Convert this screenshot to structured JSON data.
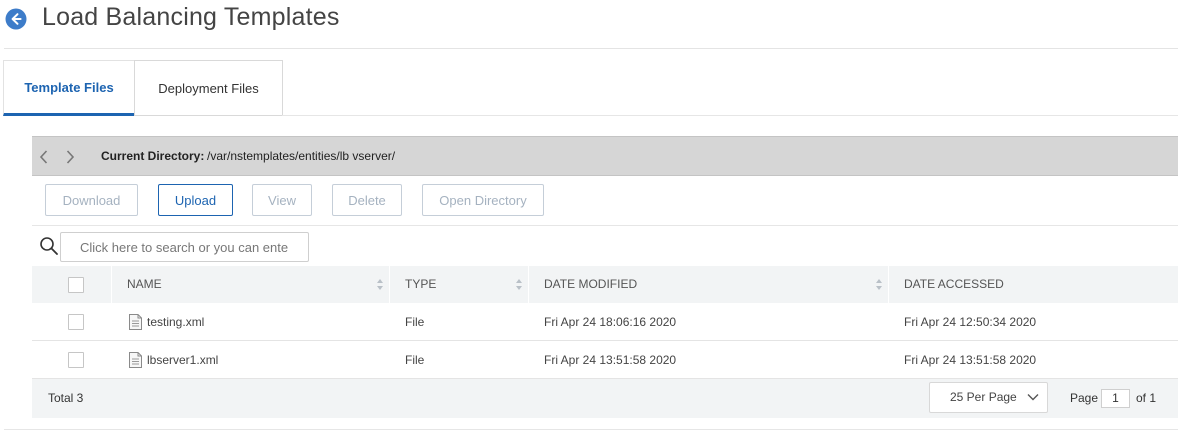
{
  "header": {
    "title": "Load Balancing Templates",
    "back_icon": "back-arrow-circle-icon",
    "accent_color": "#1d64b1"
  },
  "tabs": [
    {
      "label": "Template Files",
      "active": true
    },
    {
      "label": "Deployment Files",
      "active": false
    }
  ],
  "directory": {
    "label": "Current Directory:",
    "path": "/var/nstemplates/entities/lb vserver/"
  },
  "toolbar": {
    "download": "Download",
    "upload": "Upload",
    "view": "View",
    "delete": "Delete",
    "open_directory": "Open Directory"
  },
  "search": {
    "placeholder": "Click here to search or you can ente"
  },
  "table": {
    "columns": [
      "NAME",
      "TYPE",
      "DATE MODIFIED",
      "DATE ACCESSED"
    ],
    "rows": [
      {
        "name": "testing.xml",
        "type": "File",
        "modified": "Fri Apr 24 18:06:16 2020",
        "accessed": "Fri Apr 24 12:50:34 2020"
      },
      {
        "name": "lbserver1.xml",
        "type": "File",
        "modified": "Fri Apr 24 13:51:58 2020",
        "accessed": "Fri Apr 24 13:51:58 2020"
      }
    ]
  },
  "footer": {
    "total": "Total 3",
    "per_page": "25 Per Page",
    "page_label": "Page",
    "page_value": "1",
    "page_of": "of 1"
  }
}
